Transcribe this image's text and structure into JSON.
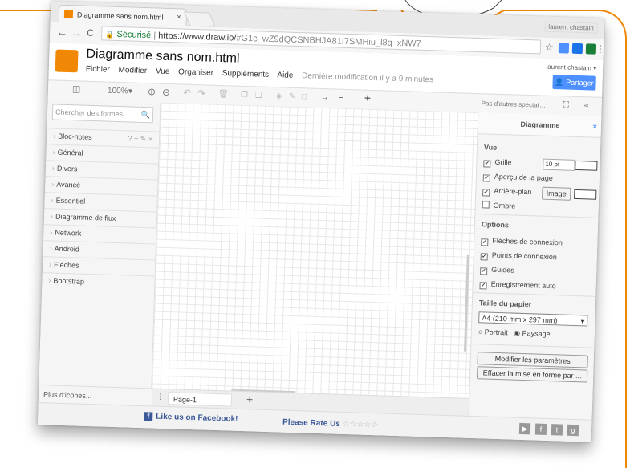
{
  "browser": {
    "tab_title": "Diagramme sans nom.html",
    "tab_close": "×",
    "window_controls": "laurent chastain",
    "secure_label": "Sécurisé",
    "url_host": "https://www.draw.io/",
    "url_hash": "#G1c_wZ9dQCSNBHJA81I7SMHiu_l8q_xNW7",
    "back_glyph": "←",
    "forward_glyph": "→",
    "reload_glyph": "C",
    "star_glyph": "☆",
    "menu_glyph": "⋮"
  },
  "app": {
    "title": "Diagramme sans nom.html",
    "menu": [
      "Fichier",
      "Modifier",
      "Vue",
      "Organiser",
      "Suppléments",
      "Aide"
    ],
    "last_modified": "Dernière modification il y a 9 minutes",
    "user": "laurent chastain ▾",
    "share_label": "Partager"
  },
  "toolbar": {
    "zoom": "100%",
    "zoom_caret": "▾",
    "zoom_in": "⊕",
    "zoom_out": "⊖",
    "undo": "↶",
    "redo": "↷",
    "delete": "🗑",
    "plus": "+",
    "arrow_glyph": "→",
    "waypoint_glyph": "⌐",
    "right_text": "Pas d'autres spectat…",
    "fullscreen": "⛶",
    "collapse": "≈"
  },
  "left_panel": {
    "search_placeholder": "Chercher des formes",
    "search_icon": "🔍",
    "libraries": [
      "Bloc-notes",
      "Général",
      "Divers",
      "Avancé",
      "Essentiel",
      "Diagramme de flux",
      "Network",
      "Android",
      "Flèches",
      "Bootstrap"
    ],
    "scratchpad_tools": "? + ✎ ×",
    "more_shapes": "Plus d'icones..."
  },
  "page": {
    "tab_label": "Page-1",
    "menu_glyph": "⋮",
    "add_glyph": "+"
  },
  "right_panel": {
    "title": "Diagramme",
    "close_glyph": "×",
    "view_heading": "Vue",
    "grid_label": "Grille",
    "grid_size": "10 pt",
    "page_view_label": "Aperçu de la page",
    "background_label": "Arrière-plan",
    "image_button": "Image",
    "shadow_label": "Ombre",
    "options_heading": "Options",
    "connection_arrows": "Flèches de connexion",
    "connection_points": "Points de connexion",
    "guides": "Guides",
    "autosave": "Enregistrement auto",
    "paper_size_heading": "Taille du papier",
    "paper_size": "A4 (210 mm x 297 mm)",
    "portrait": "Portrait",
    "landscape": "Paysage",
    "edit_settings": "Modifier les paramètres",
    "clear_format": "Effacer la mise en forme par ..."
  },
  "footer": {
    "facebook": "Like us on Facebook!",
    "rate": "Please Rate Us",
    "stars": "☆☆☆☆☆"
  },
  "colors": {
    "accent": "#f08705",
    "share_blue": "#4d90fe",
    "facebook_blue": "#3b5998"
  }
}
